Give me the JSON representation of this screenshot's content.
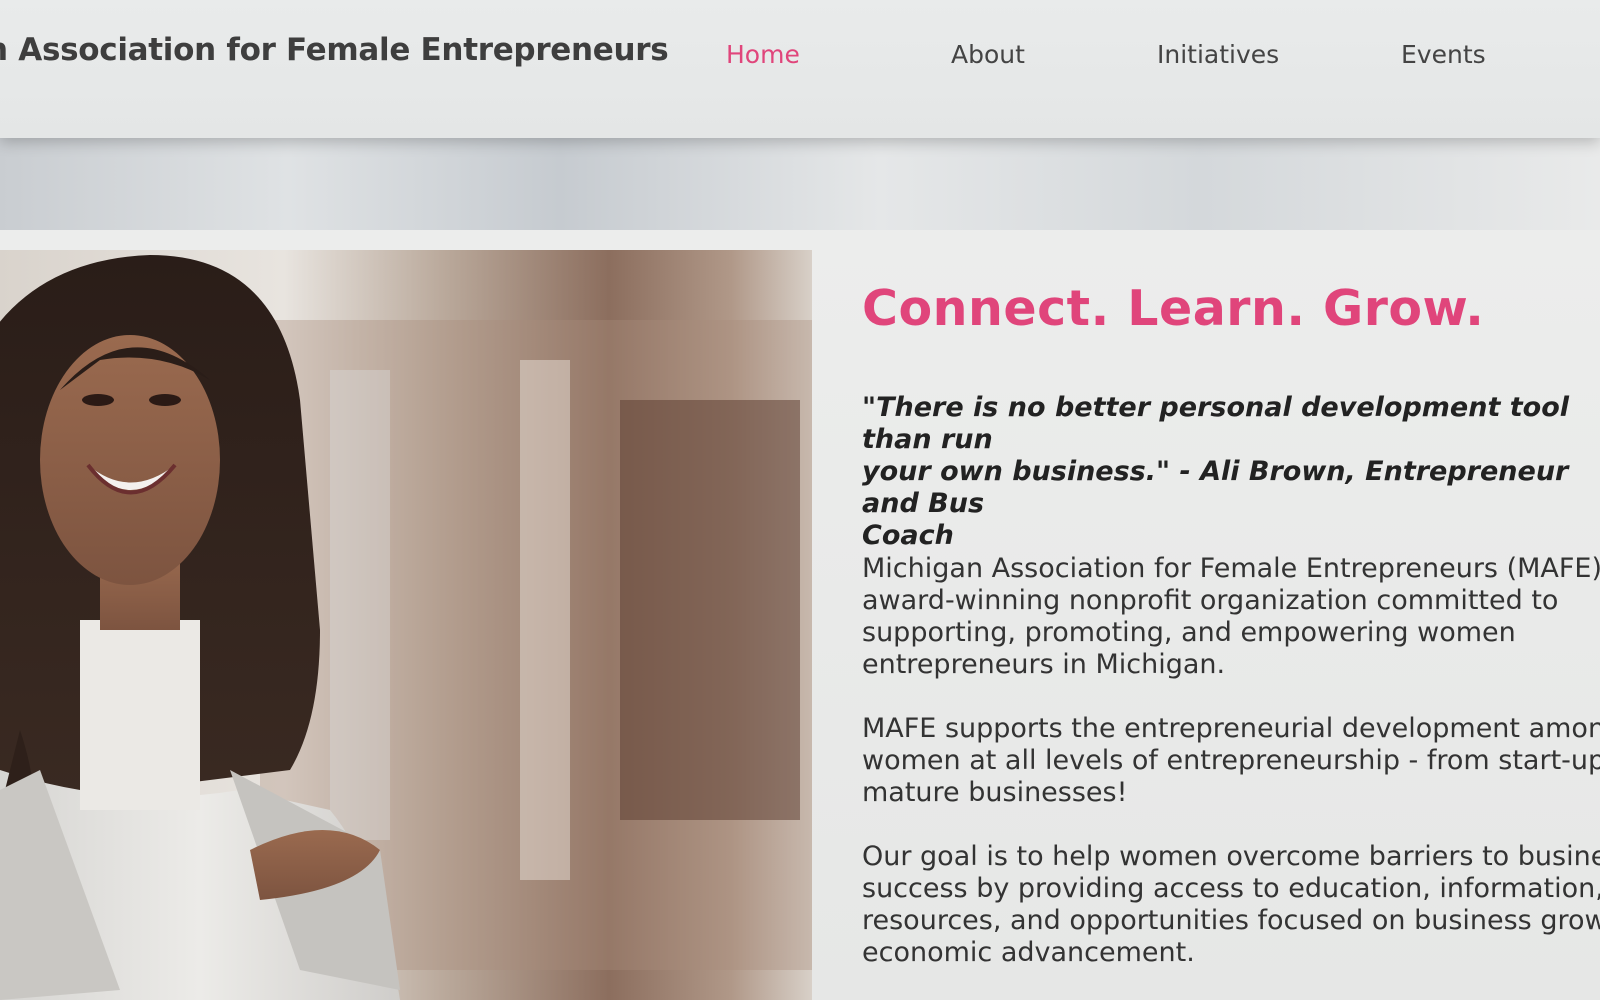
{
  "header": {
    "site_title": "n Association for Female Entrepreneurs",
    "nav": [
      {
        "label": "Home",
        "active": true
      },
      {
        "label": "About",
        "active": false
      },
      {
        "label": "Initiatives",
        "active": false
      },
      {
        "label": "Events",
        "active": false
      }
    ]
  },
  "main": {
    "headline": "Connect. Learn. Grow.",
    "quote": "\"There is no better personal development tool than run\nyour own business.\" - Ali Brown, Entrepreneur and Bus\nCoach",
    "paragraphs": [
      "Michigan Association for Female Entrepreneurs (MAFE)\naward-winning nonprofit organization committed to\nsupporting, promoting, and empowering women\nentrepreneurs in Michigan.",
      "MAFE supports the entrepreneurial development amon\nwomen at all levels of entrepreneurship - from start-up\nmature businesses!",
      "Our goal is to help women overcome barriers to busine\nsuccess by providing access to education, information,\nresources, and opportunities focused on business grow\neconomic advancement."
    ]
  },
  "colors": {
    "accent": "#e0457b",
    "nav_text": "#444444",
    "body_text": "#333333"
  }
}
